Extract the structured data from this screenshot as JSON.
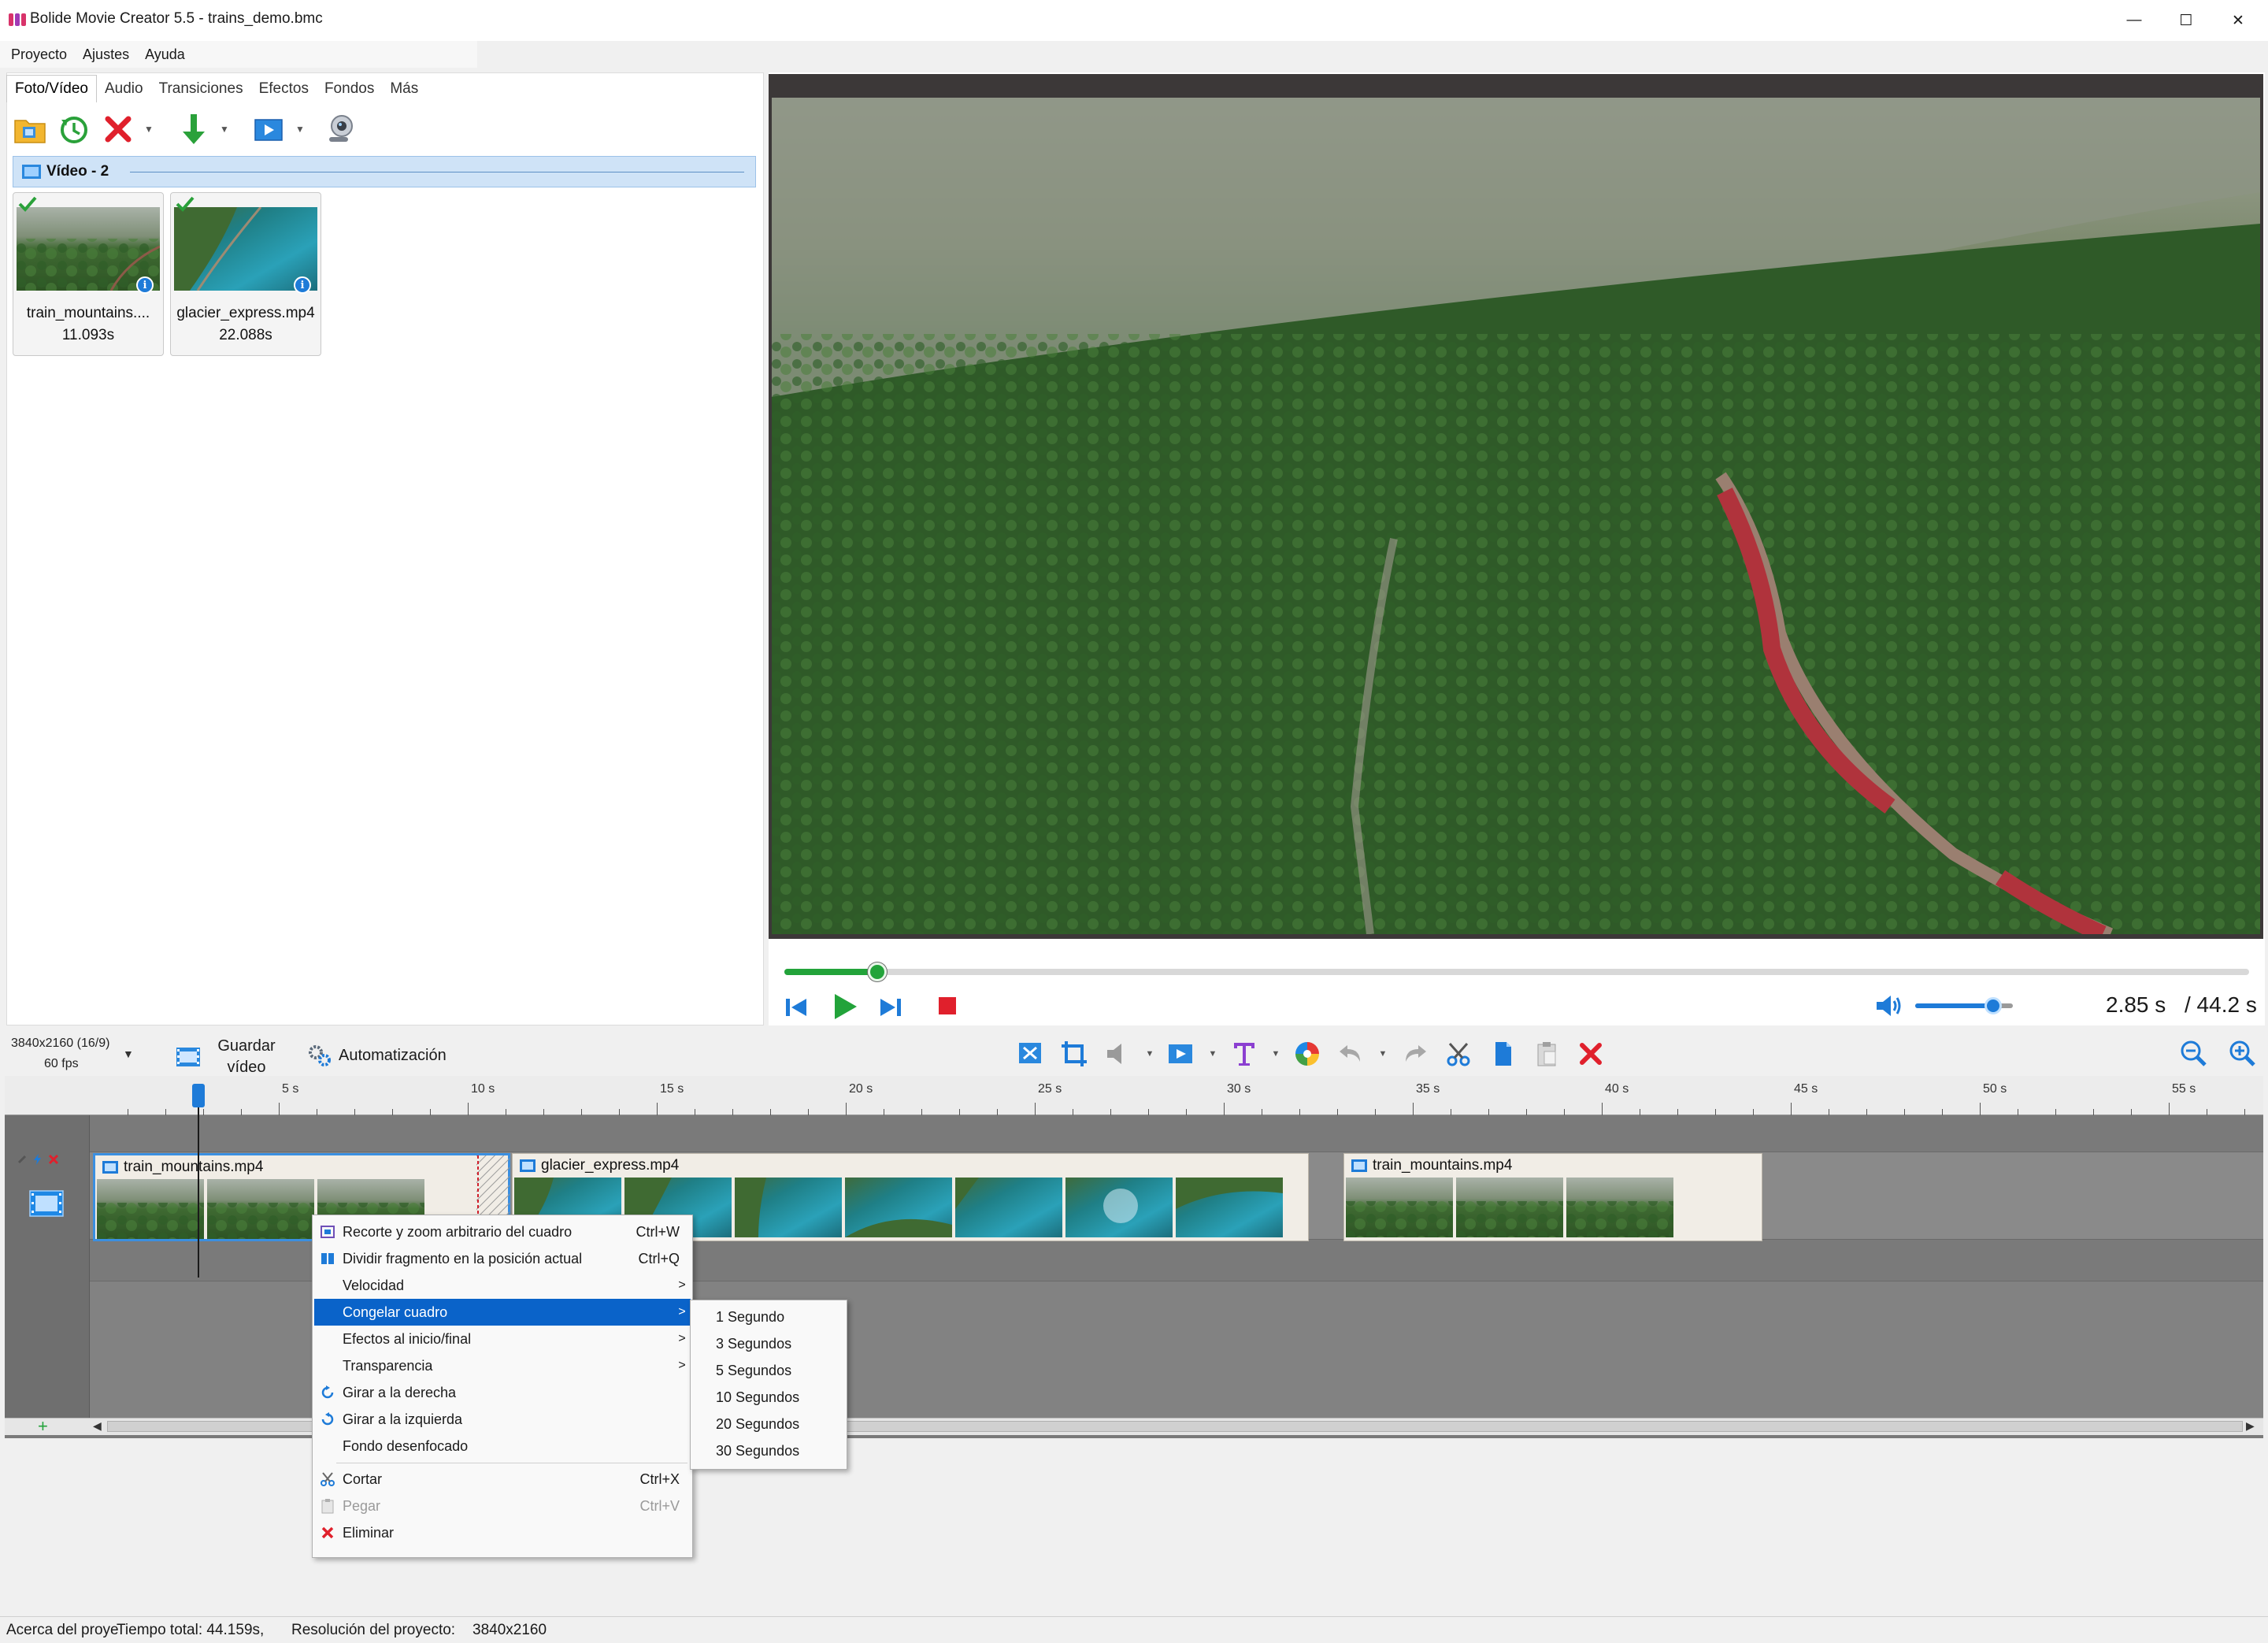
{
  "window": {
    "title": "Bolide Movie Creator 5.5 - trains_demo.bmc",
    "minimize": "—",
    "maximize": "☐",
    "close": "✕"
  },
  "menubar": [
    "Proyecto",
    "Ajustes",
    "Ayuda"
  ],
  "tabs": [
    "Foto/Vídeo",
    "Audio",
    "Transiciones",
    "Efectos",
    "Fondos",
    "Más"
  ],
  "library": {
    "group_title": "Vídeo - 2",
    "items": [
      {
        "name": "train_mountains....",
        "duration": "11.093s"
      },
      {
        "name": "glacier_express.mp4",
        "duration": "22.088s"
      }
    ],
    "info_glyph": "i"
  },
  "player": {
    "current_time": "2.85 s",
    "total_time": "/ 44.2 s",
    "progress_fraction": 0.064,
    "volume_fraction": 0.8
  },
  "project": {
    "resolution": "3840x2160 (16/9)",
    "fps": "60 fps",
    "dropdown": "▼",
    "save_label": "Guardar vídeo",
    "automation_label": "Automatización"
  },
  "timeline": {
    "ticks": [
      "5 s",
      "10 s",
      "15 s",
      "20 s",
      "25 s",
      "30 s",
      "35 s",
      "40 s",
      "45 s",
      "50 s",
      "55 s"
    ],
    "clips": [
      "train_mountains.mp4",
      "glacier_express.mp4",
      "train_mountains.mp4"
    ],
    "add_track": "+",
    "scroll_left": "◀",
    "scroll_right": "▶"
  },
  "context_menu": {
    "items": [
      {
        "label": "Recorte y zoom arbitrario del cuadro",
        "shortcut": "Ctrl+W",
        "sub": ""
      },
      {
        "label": "Dividir fragmento en la posición actual",
        "shortcut": "Ctrl+Q",
        "sub": ""
      },
      {
        "label": "Velocidad",
        "shortcut": "",
        "sub": ">"
      },
      {
        "label": "Congelar cuadro",
        "shortcut": "",
        "sub": ">"
      },
      {
        "label": "Efectos al inicio/final",
        "shortcut": "",
        "sub": ">"
      },
      {
        "label": "Transparencia",
        "shortcut": "",
        "sub": ">"
      },
      {
        "label": "Girar a la derecha",
        "shortcut": "",
        "sub": ""
      },
      {
        "label": "Girar a la izquierda",
        "shortcut": "",
        "sub": ""
      },
      {
        "label": "Fondo desenfocado",
        "shortcut": "",
        "sub": ""
      },
      {
        "label": "Cortar",
        "shortcut": "Ctrl+X",
        "sub": ""
      },
      {
        "label": "Pegar",
        "shortcut": "Ctrl+V",
        "sub": ""
      },
      {
        "label": "Eliminar",
        "shortcut": "",
        "sub": ""
      }
    ],
    "submenu": [
      "1 Segundo",
      "3 Segundos",
      "5 Segundos",
      "10 Segundos",
      "20 Segundos",
      "30 Segundos"
    ]
  },
  "status": {
    "about": "Acerca del proye",
    "total": "Tiempo total: 44.159s,",
    "res_label": "Resolución del proyecto:",
    "res_value": "3840x2160"
  },
  "colors": {
    "accent": "#1e7bd8",
    "play_green": "#22a33a",
    "delete_red": "#e0202c",
    "menu_highlight": "#0a63c9"
  }
}
